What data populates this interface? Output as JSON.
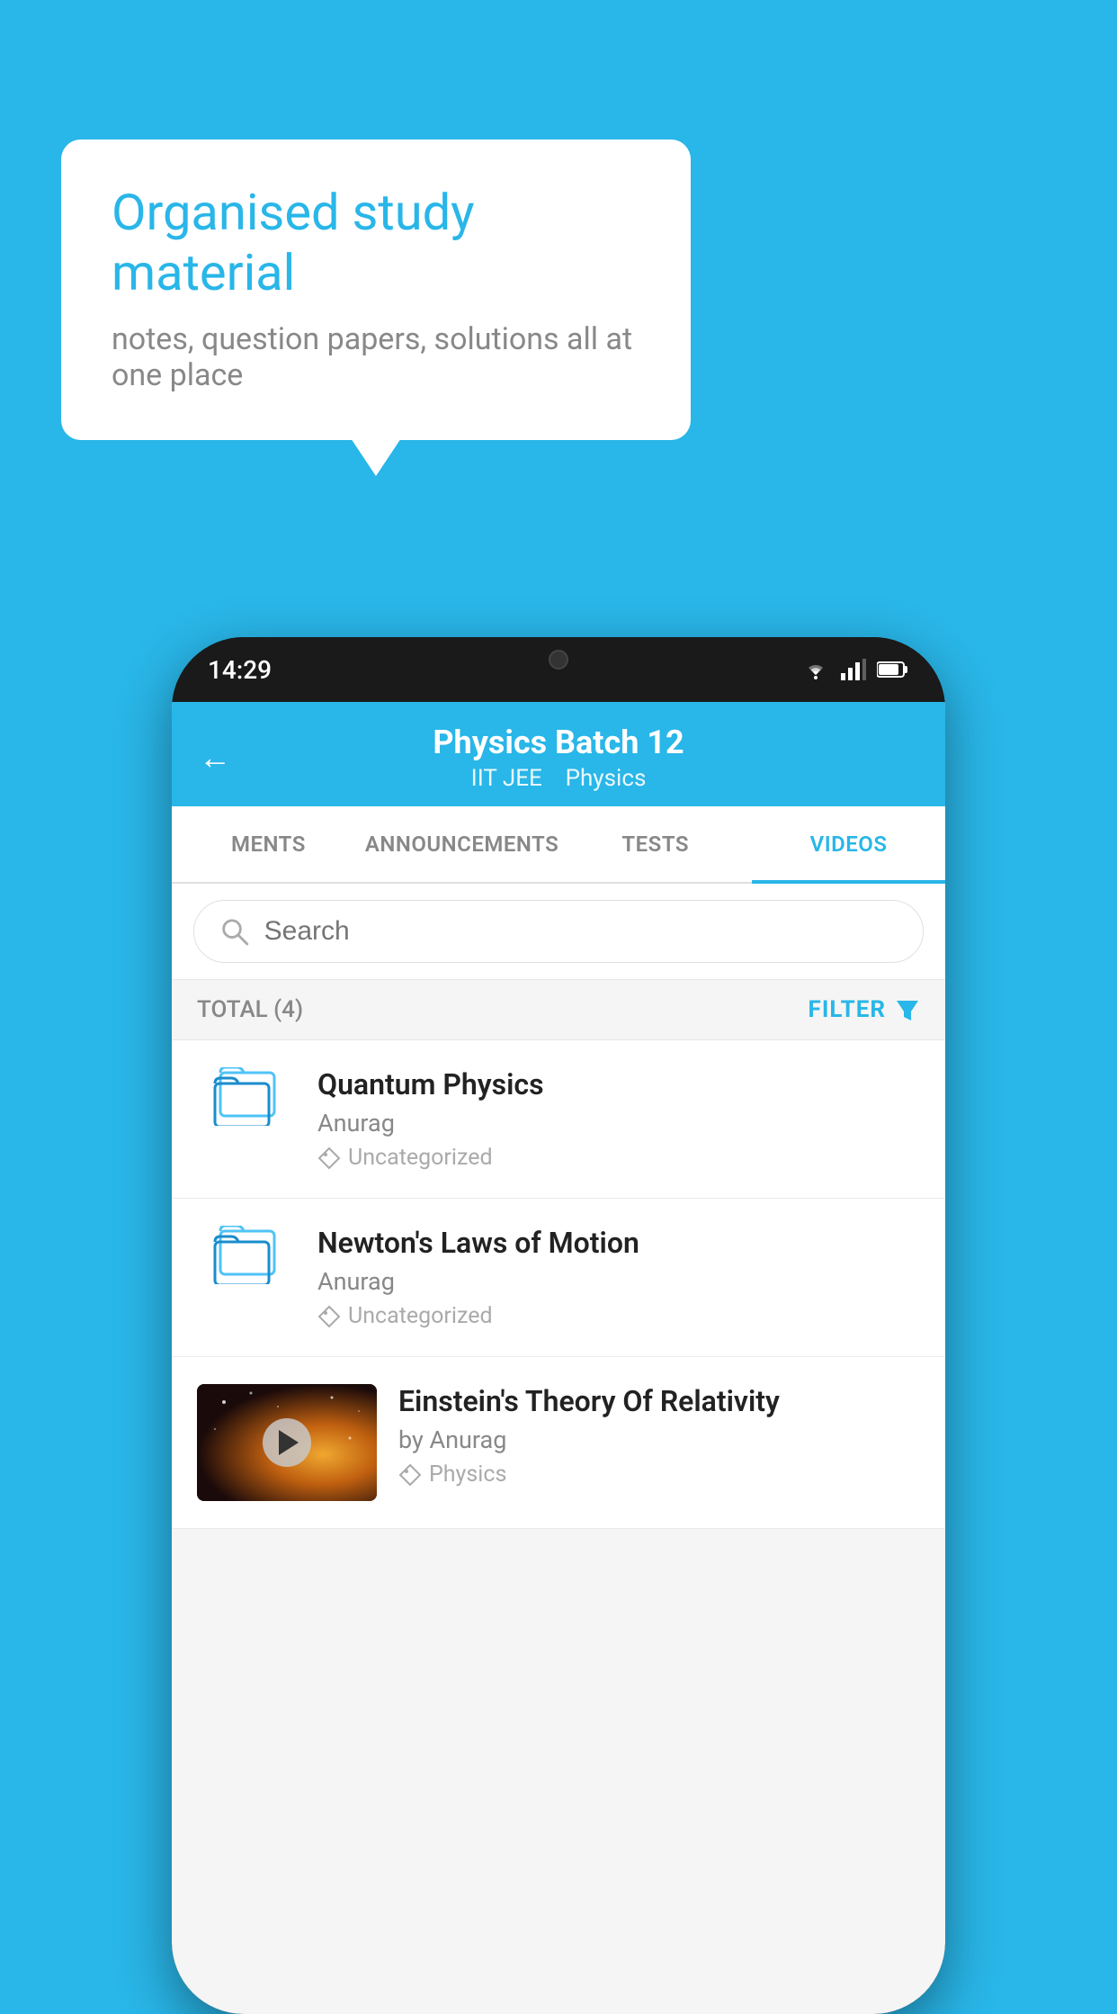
{
  "background_color": "#29b6e8",
  "speech_bubble": {
    "heading": "Organised study material",
    "subtext": "notes, question papers, solutions all at one place"
  },
  "phone": {
    "status_bar": {
      "time": "14:29"
    },
    "header": {
      "title": "Physics Batch 12",
      "subtitle_tag1": "IIT JEE",
      "subtitle_tag2": "Physics",
      "back_label": "←"
    },
    "tabs": [
      {
        "label": "MENTS",
        "active": false
      },
      {
        "label": "ANNOUNCEMENTS",
        "active": false
      },
      {
        "label": "TESTS",
        "active": false
      },
      {
        "label": "VIDEOS",
        "active": true
      }
    ],
    "search": {
      "placeholder": "Search"
    },
    "filter_row": {
      "total_label": "TOTAL (4)",
      "filter_label": "FILTER"
    },
    "videos": [
      {
        "id": 1,
        "title": "Quantum Physics",
        "author": "Anurag",
        "tag": "Uncategorized",
        "has_thumb": false
      },
      {
        "id": 2,
        "title": "Newton's Laws of Motion",
        "author": "Anurag",
        "tag": "Uncategorized",
        "has_thumb": false
      },
      {
        "id": 3,
        "title": "Einstein's Theory Of Relativity",
        "author": "by Anurag",
        "tag": "Physics",
        "has_thumb": true
      }
    ]
  }
}
